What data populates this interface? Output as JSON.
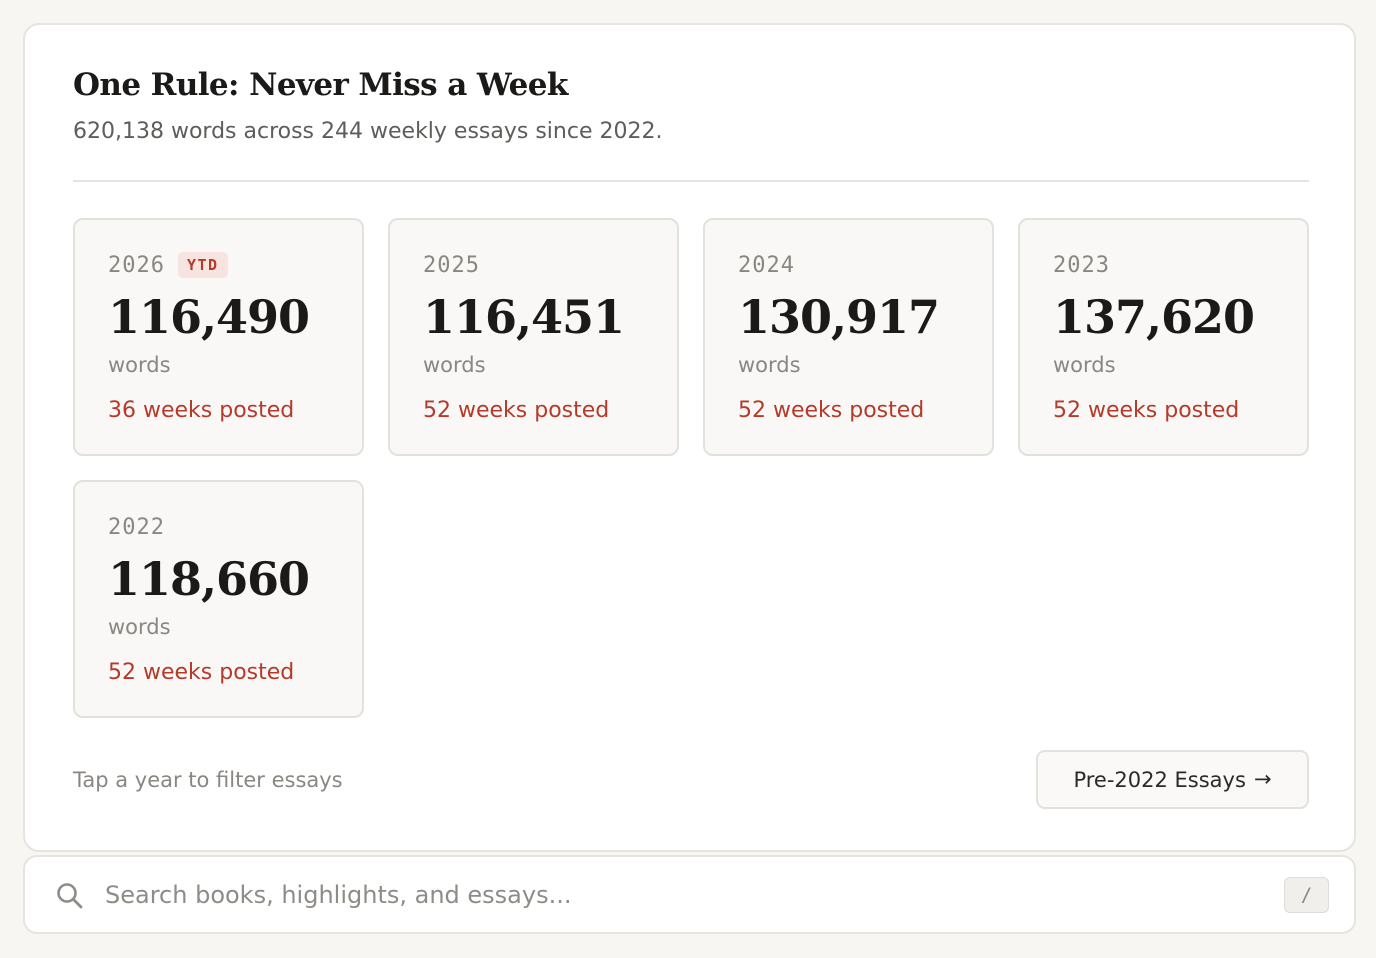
{
  "panel": {
    "title": "One Rule: Never Miss a Week",
    "subtitle": "620,138 words across 244 weekly essays since 2022."
  },
  "years": [
    {
      "year": "2026",
      "badge": "YTD",
      "words": "116,490",
      "unit": "words",
      "weeks": "36 weeks posted"
    },
    {
      "year": "2025",
      "badge": "",
      "words": "116,451",
      "unit": "words",
      "weeks": "52 weeks posted"
    },
    {
      "year": "2024",
      "badge": "",
      "words": "130,917",
      "unit": "words",
      "weeks": "52 weeks posted"
    },
    {
      "year": "2023",
      "badge": "",
      "words": "137,620",
      "unit": "words",
      "weeks": "52 weeks posted"
    },
    {
      "year": "2022",
      "badge": "",
      "words": "118,660",
      "unit": "words",
      "weeks": "52 weeks posted"
    }
  ],
  "footer": {
    "hint": "Tap a year to filter essays",
    "pre_button_label": "Pre-2022 Essays",
    "pre_button_arrow": "→"
  },
  "search": {
    "placeholder": "Search books, highlights, and essays...",
    "shortcut": "/",
    "icon": "search-icon"
  },
  "colors": {
    "accent": "#b53a2a",
    "background": "#f7f6f3",
    "card": "#ffffff",
    "year_card": "#f9f8f6"
  }
}
